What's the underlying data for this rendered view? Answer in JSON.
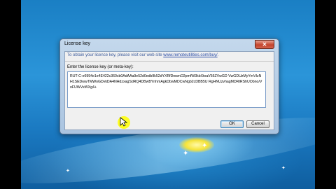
{
  "dialog": {
    "title": "License key",
    "close_symbol": "✕",
    "info_text": "To obtain your licence key, please visit our web site",
    "info_link": "www.remoteutilities.com/buy/",
    "info_suffix": ".",
    "input_label": "Enter the license key (or meta-key):",
    "license_key_value": "RUT-C-e6994e1e4E422c360cb0AdAAa9e52d0edb9k52dYXRfDwwnO2pmfW3kbXtoaV56ZVwGD VwGDUzMyYmVIzNH1SEDwwTMWoGDvkDA4NHdzxagSdRQ4DBwBYnhmAgkDbwMDCwNgb2cDBB5U RgHNUzvhagMDRIRShUObno/VoFUWVxWXg4+",
    "ok_label": "OK",
    "cancel_label": "Cancel"
  },
  "colors": {
    "desktop_blue": "#1a7fc4",
    "dialog_frame": "#c4d8ec",
    "link_blue": "#2a4ea8",
    "close_red": "#c4442c",
    "cursor_highlight": "#ffff00"
  },
  "icons": {
    "close": "close-icon",
    "cursor": "mouse-cursor-icon"
  }
}
